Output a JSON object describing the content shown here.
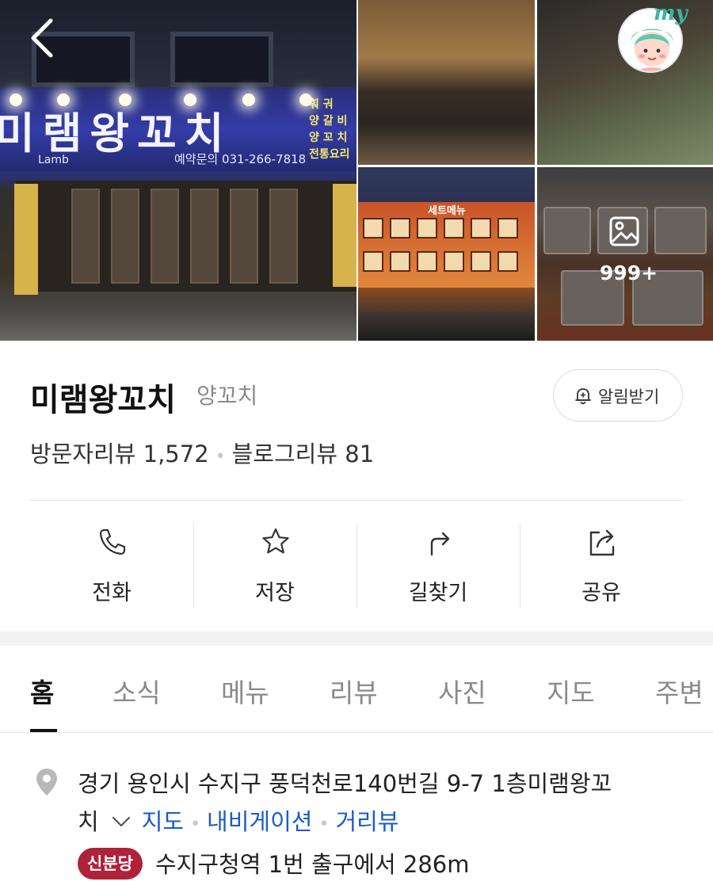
{
  "colors": {
    "accent_link": "#1a5cc8",
    "station_badge": "#b0213a",
    "text_primary": "#111111",
    "text_secondary": "#8a8a8a"
  },
  "gallery": {
    "storefront_sign": {
      "name": "미램왕꼬치",
      "english": "Lamb",
      "phone": "예약문의 031-266-7818",
      "side_lines": [
        "훠  궈",
        "양 갈 비",
        "양 꼬 치",
        "전통요리"
      ]
    },
    "menu_board_title": "세트메뉴",
    "more_photos_count": "999+",
    "back_icon": "chevron-left-icon",
    "my_badge": "my"
  },
  "place": {
    "name": "미램왕꼬치",
    "category": "양꼬치",
    "notify_label": "알림받기",
    "visitor_review_label": "방문자리뷰",
    "visitor_review_count": "1,572",
    "blog_review_label": "블로그리뷰",
    "blog_review_count": "81"
  },
  "actions": [
    {
      "label": "전화",
      "icon": "phone-icon"
    },
    {
      "label": "저장",
      "icon": "star-icon"
    },
    {
      "label": "길찾기",
      "icon": "directions-icon"
    },
    {
      "label": "공유",
      "icon": "share-icon"
    }
  ],
  "tabs": [
    {
      "label": "홈",
      "active": true
    },
    {
      "label": "소식",
      "active": false
    },
    {
      "label": "메뉴",
      "active": false
    },
    {
      "label": "리뷰",
      "active": false
    },
    {
      "label": "사진",
      "active": false
    },
    {
      "label": "지도",
      "active": false
    },
    {
      "label": "주변",
      "active": false
    }
  ],
  "address": {
    "line1": "경기 용인시 수지구 풍덕천로140번길 9-7 1층미램왕꼬",
    "line2": "치",
    "links": [
      "지도",
      "내비게이션",
      "거리뷰"
    ],
    "station_line": "신분당",
    "station_text": "수지구청역 1번 출구에서 286m"
  }
}
